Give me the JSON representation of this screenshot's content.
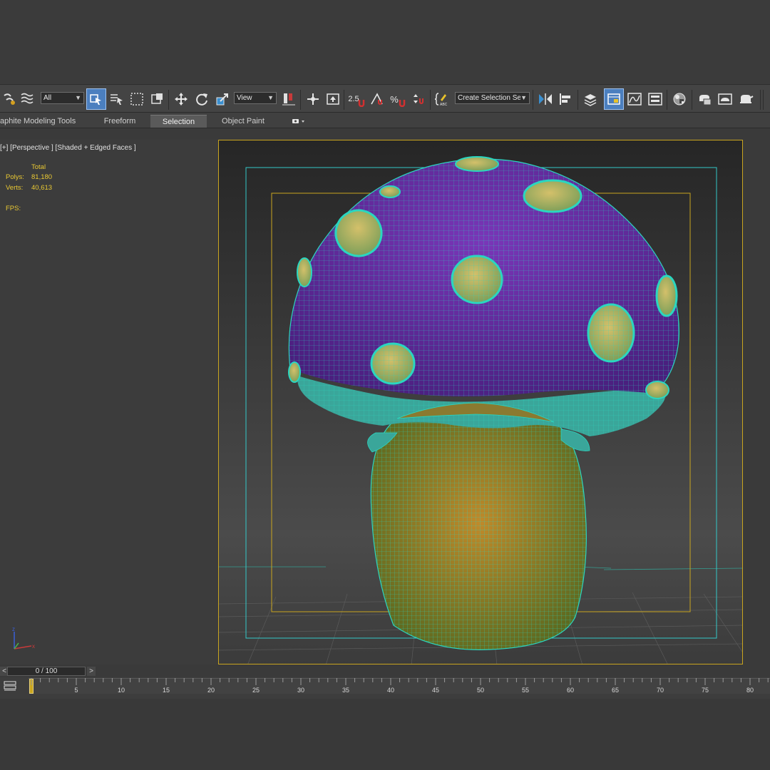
{
  "toolbar": {
    "filter_select": "All",
    "refcoord_select": "View",
    "snap_angle_label": "2.5",
    "snap_percent_label": "%",
    "named_selection_set": "Create Selection Se",
    "icons": [
      "link-icon",
      "bind-icon",
      "select-object-icon",
      "select-by-name-icon",
      "rect-region-icon",
      "window-crossing-icon",
      "move-icon",
      "rotate-icon",
      "scale-icon",
      "pivot-icon",
      "snap-toggle-icon",
      "angle-snap-icon",
      "percent-snap-icon",
      "spinner-snap-icon",
      "edit-named-set-icon",
      "mirror-icon",
      "align-icon",
      "layer-manager-icon",
      "scene-explorer-icon",
      "curve-editor-icon",
      "schematic-view-icon",
      "material-editor-icon",
      "render-setup-icon",
      "rendered-frame-icon",
      "render-icon"
    ]
  },
  "ribbon": {
    "title": "aphite Modeling Tools",
    "tabs": [
      "Freeform",
      "Selection",
      "Object Paint"
    ],
    "active_tab": "Selection"
  },
  "viewport": {
    "label": "[+] [Perspective ] [Shaded + Edged Faces ]",
    "stats": {
      "header": "Total",
      "polys_label": "Polys:",
      "polys_value": "81,180",
      "verts_label": "Verts:",
      "verts_value": "40,613",
      "fps_label": "FPS:"
    },
    "axis": {
      "x": "x",
      "z": "z"
    },
    "colors": {
      "cap": "#6b2fa0",
      "spots": "#c9b55a",
      "stem": "#b7862a",
      "wire": "#2ad6c0",
      "safe_frame_outer": "#33c8c8",
      "safe_frame_inner": "#c9a51f"
    }
  },
  "timeline": {
    "slider_label": "0 / 100",
    "prev": "<",
    "next": ">",
    "ticks": [
      "5",
      "10",
      "15",
      "20",
      "25",
      "30",
      "35",
      "40",
      "45",
      "50",
      "55",
      "60",
      "65",
      "70",
      "75",
      "80"
    ]
  }
}
